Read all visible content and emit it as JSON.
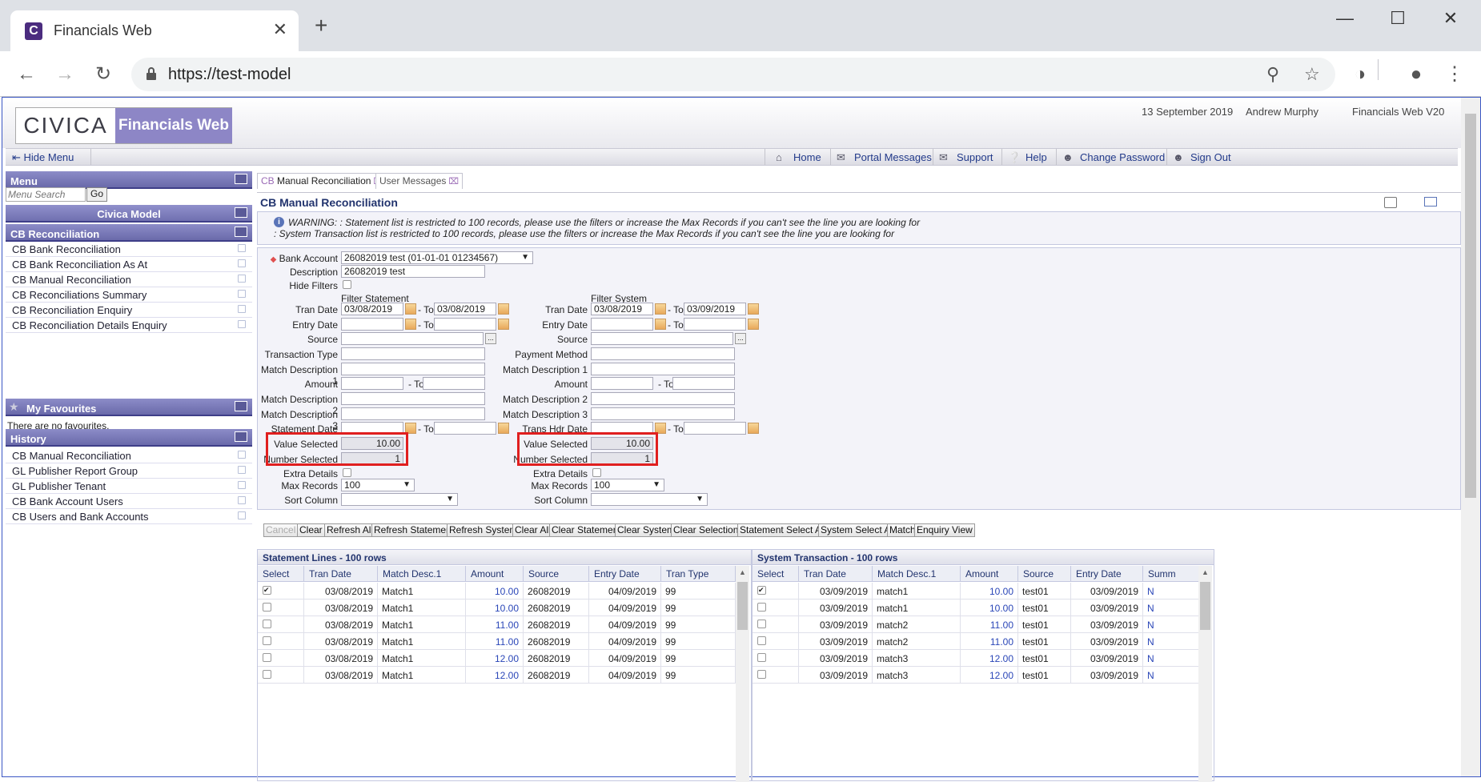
{
  "browser": {
    "tab_title": "Financials Web",
    "url": "https://test-model",
    "new_tab": "+",
    "tab_close": "✕"
  },
  "header": {
    "logo_brand": "CIVICA",
    "logo_product": "Financials Web",
    "date": "13 September 2019",
    "user": "Andrew Murphy",
    "version": "Financials Web V20"
  },
  "topnav": {
    "hide_menu": "Hide Menu",
    "items": [
      "Home",
      "Portal Messages",
      "Support",
      "Help",
      "Change Password",
      "Sign Out"
    ]
  },
  "sidebar": {
    "menu_title": "Menu",
    "search_placeholder": "Menu Search",
    "go": "Go",
    "model": "Civica Model",
    "section": "CB Reconciliation",
    "items": [
      "CB Bank Reconciliation",
      "CB Bank Reconciliation As At",
      "CB Manual Reconciliation",
      "CB Reconciliations Summary",
      "CB Reconciliation Enquiry",
      "CB Reconciliation Details Enquiry"
    ],
    "favourites_title": "My Favourites",
    "favourites_empty": "There are no favourites.",
    "history_title": "History",
    "history": [
      "CB Manual Reconciliation",
      "GL Publisher Report Group",
      "GL Publisher Tenant",
      "CB Bank Account Users",
      "CB Users and Bank Accounts"
    ]
  },
  "tabs": {
    "active_prefix": "CB",
    "active": "Manual Reconciliation",
    "other": "User Messages"
  },
  "panel": {
    "title": "CB Manual Reconciliation",
    "warning1": "WARNING: : Statement list is restricted to 100 records, please use the filters or increase the Max Records if you can't see the line you are looking for",
    "warning2": ": System Transaction list is restricted to 100 records, please use the filters or increase the Max Records if you can't see the line you are looking for"
  },
  "filters": {
    "bank_account_label": "Bank Account",
    "bank_account": "26082019 test (01-01-01 01234567)",
    "description_label": "Description",
    "description": "26082019 test",
    "hide_filters_label": "Hide Filters",
    "filter_statement": "Filter Statement",
    "filter_system": "Filter System",
    "to": "- To",
    "stmt": {
      "tran_date_label": "Tran Date",
      "tran_date_from": "03/08/2019",
      "tran_date_to": "03/08/2019",
      "entry_date_label": "Entry Date",
      "source_label": "Source",
      "transaction_type_label": "Transaction Type",
      "match1_label": "Match Description 1",
      "amount_label": "Amount",
      "match2_label": "Match Description 2",
      "match3_label": "Match Description 3",
      "statement_date_label": "Statement Date",
      "value_selected_label": "Value Selected",
      "value_selected": "10.00",
      "number_selected_label": "Number Selected",
      "number_selected": "1",
      "extra_details_label": "Extra Details",
      "max_records_label": "Max Records",
      "max_records": "100",
      "sort_column_label": "Sort Column"
    },
    "sys": {
      "tran_date_label": "Tran Date",
      "tran_date_from": "03/08/2019",
      "tran_date_to": "03/09/2019",
      "entry_date_label": "Entry Date",
      "source_label": "Source",
      "payment_method_label": "Payment Method",
      "match1_label": "Match Description 1",
      "amount_label": "Amount",
      "match2_label": "Match Description 2",
      "match3_label": "Match Description 3",
      "trans_hdr_date_label": "Trans Hdr Date",
      "value_selected_label": "Value Selected",
      "value_selected": "10.00",
      "number_selected_label": "Number Selected",
      "number_selected": "1",
      "extra_details_label": "Extra Details",
      "max_records_label": "Max Records",
      "max_records": "100",
      "sort_column_label": "Sort Column"
    }
  },
  "buttons": [
    "Cancel",
    "Clear",
    "Refresh All",
    "Refresh Statement",
    "Refresh System",
    "Clear All",
    "Clear Statement",
    "Clear System",
    "Clear Selections",
    "Statement Select All",
    "System Select All",
    "Match",
    "Enquiry View"
  ],
  "statement_grid": {
    "title": "Statement Lines - 100 rows",
    "columns": [
      "Select",
      "Tran Date",
      "Match Desc.1",
      "Amount",
      "Source",
      "Entry Date",
      "Tran Type"
    ],
    "rows": [
      {
        "checked": true,
        "tran_date": "03/08/2019",
        "match": "Match1",
        "amount": "10.00",
        "source": "26082019",
        "entry_date": "04/09/2019",
        "type": "99"
      },
      {
        "checked": false,
        "tran_date": "03/08/2019",
        "match": "Match1",
        "amount": "10.00",
        "source": "26082019",
        "entry_date": "04/09/2019",
        "type": "99"
      },
      {
        "checked": false,
        "tran_date": "03/08/2019",
        "match": "Match1",
        "amount": "11.00",
        "source": "26082019",
        "entry_date": "04/09/2019",
        "type": "99"
      },
      {
        "checked": false,
        "tran_date": "03/08/2019",
        "match": "Match1",
        "amount": "11.00",
        "source": "26082019",
        "entry_date": "04/09/2019",
        "type": "99"
      },
      {
        "checked": false,
        "tran_date": "03/08/2019",
        "match": "Match1",
        "amount": "12.00",
        "source": "26082019",
        "entry_date": "04/09/2019",
        "type": "99"
      },
      {
        "checked": false,
        "tran_date": "03/08/2019",
        "match": "Match1",
        "amount": "12.00",
        "source": "26082019",
        "entry_date": "04/09/2019",
        "type": "99"
      }
    ]
  },
  "system_grid": {
    "title": "System Transaction - 100 rows",
    "columns": [
      "Select",
      "Tran Date",
      "Match Desc.1",
      "Amount",
      "Source",
      "Entry Date",
      "Summ"
    ],
    "rows": [
      {
        "checked": true,
        "tran_date": "03/09/2019",
        "match": "match1",
        "amount": "10.00",
        "source": "test01",
        "entry_date": "03/09/2019",
        "summ": "N"
      },
      {
        "checked": false,
        "tran_date": "03/09/2019",
        "match": "match1",
        "amount": "10.00",
        "source": "test01",
        "entry_date": "03/09/2019",
        "summ": "N"
      },
      {
        "checked": false,
        "tran_date": "03/09/2019",
        "match": "match2",
        "amount": "11.00",
        "source": "test01",
        "entry_date": "03/09/2019",
        "summ": "N"
      },
      {
        "checked": false,
        "tran_date": "03/09/2019",
        "match": "match2",
        "amount": "11.00",
        "source": "test01",
        "entry_date": "03/09/2019",
        "summ": "N"
      },
      {
        "checked": false,
        "tran_date": "03/09/2019",
        "match": "match3",
        "amount": "12.00",
        "source": "test01",
        "entry_date": "03/09/2019",
        "summ": "N"
      },
      {
        "checked": false,
        "tran_date": "03/09/2019",
        "match": "match3",
        "amount": "12.00",
        "source": "test01",
        "entry_date": "03/09/2019",
        "summ": "N"
      }
    ]
  }
}
